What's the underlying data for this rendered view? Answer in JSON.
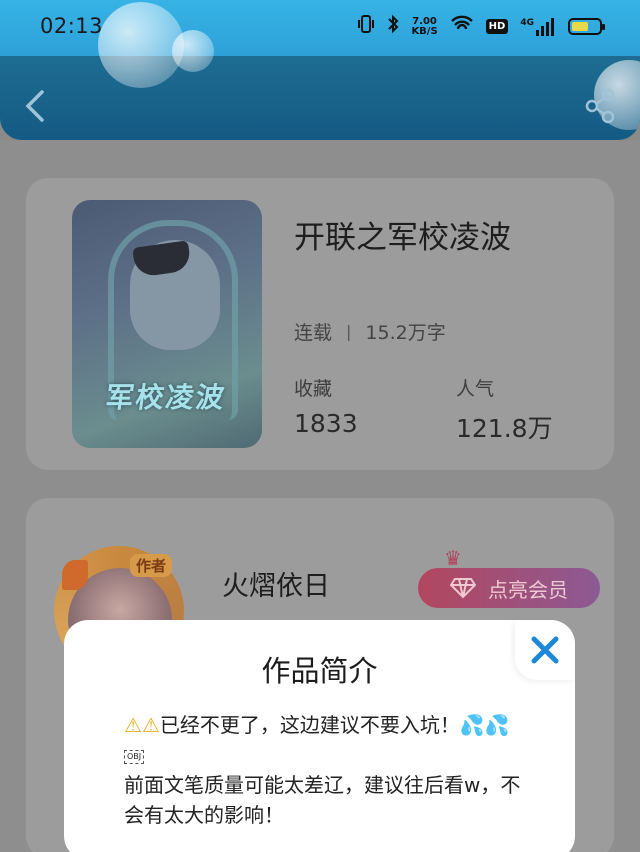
{
  "status_bar": {
    "time": "02:13",
    "speed_value": "7.00",
    "speed_unit": "KB/S",
    "hd_label": "HD",
    "net_label": "4G",
    "battery_level": 0.6
  },
  "book": {
    "cover_title": "军校凌波",
    "title": "开联之军校凌波",
    "status": "连载",
    "separator": "|",
    "word_count": "15.2万字",
    "favorites_label": "收藏",
    "favorites_value": "1833",
    "popularity_label": "人气",
    "popularity_value": "121.8万"
  },
  "author": {
    "badge": "作者",
    "name": "火熠依日",
    "vip_button": "点亮会员"
  },
  "intro_sheet": {
    "title": "作品简介",
    "warning_icons": "⚠⚠",
    "line1_text": "已经不更了，这边建议不要入坑！",
    "sweat_icons": "💦💦",
    "obj_marker": "OBJ",
    "body_rest": "前面文笔质量可能太差辽，建议往后看w，不会有太大的影响！"
  },
  "colors": {
    "header_top": "#37b3e6",
    "header_bottom": "#1e85c3",
    "close_accent": "#1e88d8",
    "vip_start": "#b3465e",
    "vip_end": "#8c5a93"
  }
}
